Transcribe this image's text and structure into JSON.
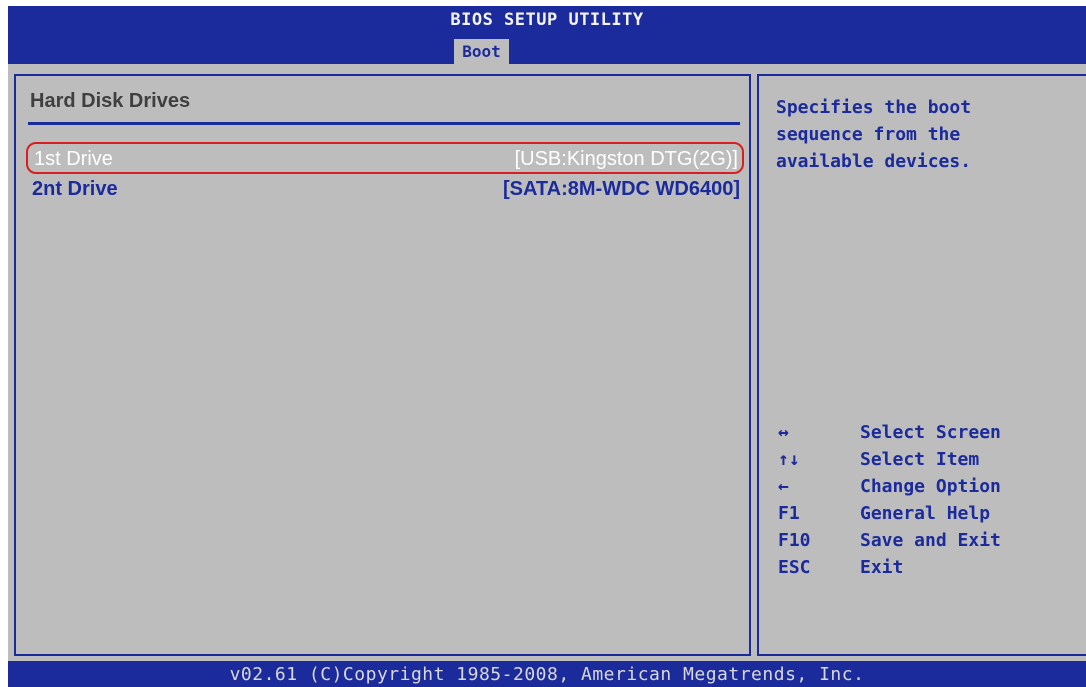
{
  "header": {
    "title": "BIOS SETUP UTILITY",
    "active_tab": "Boot"
  },
  "left_panel": {
    "section_title": "Hard Disk Drives",
    "items": [
      {
        "label": "1st Drive",
        "value": "[USB:Kingston DTG(2G)]",
        "selected": true
      },
      {
        "label": "2nt Drive",
        "value": "[SATA:8M-WDC WD6400]",
        "selected": false
      }
    ]
  },
  "right_panel": {
    "help_text": "Specifies the boot\nsequence from the\navailable devices.",
    "keys": [
      {
        "key": "↔",
        "action": "Select Screen",
        "icon": "left-right-arrow-icon"
      },
      {
        "key": "↑↓",
        "action": "Select Item",
        "icon": "up-down-arrow-icon"
      },
      {
        "key": "←",
        "action": "Change Option",
        "icon": "left-arrow-icon"
      },
      {
        "key": "F1",
        "action": "General Help"
      },
      {
        "key": "F10",
        "action": "Save and Exit"
      },
      {
        "key": "ESC",
        "action": "Exit"
      }
    ]
  },
  "footer": {
    "copyright": "v02.61 (C)Copyright 1985-2008, American Megatrends, Inc."
  },
  "colors": {
    "bios_blue": "#1c2b9b",
    "panel_gray": "#bdbdbd",
    "selection_outline": "#d81e1e",
    "selected_text": "#ffffff"
  }
}
